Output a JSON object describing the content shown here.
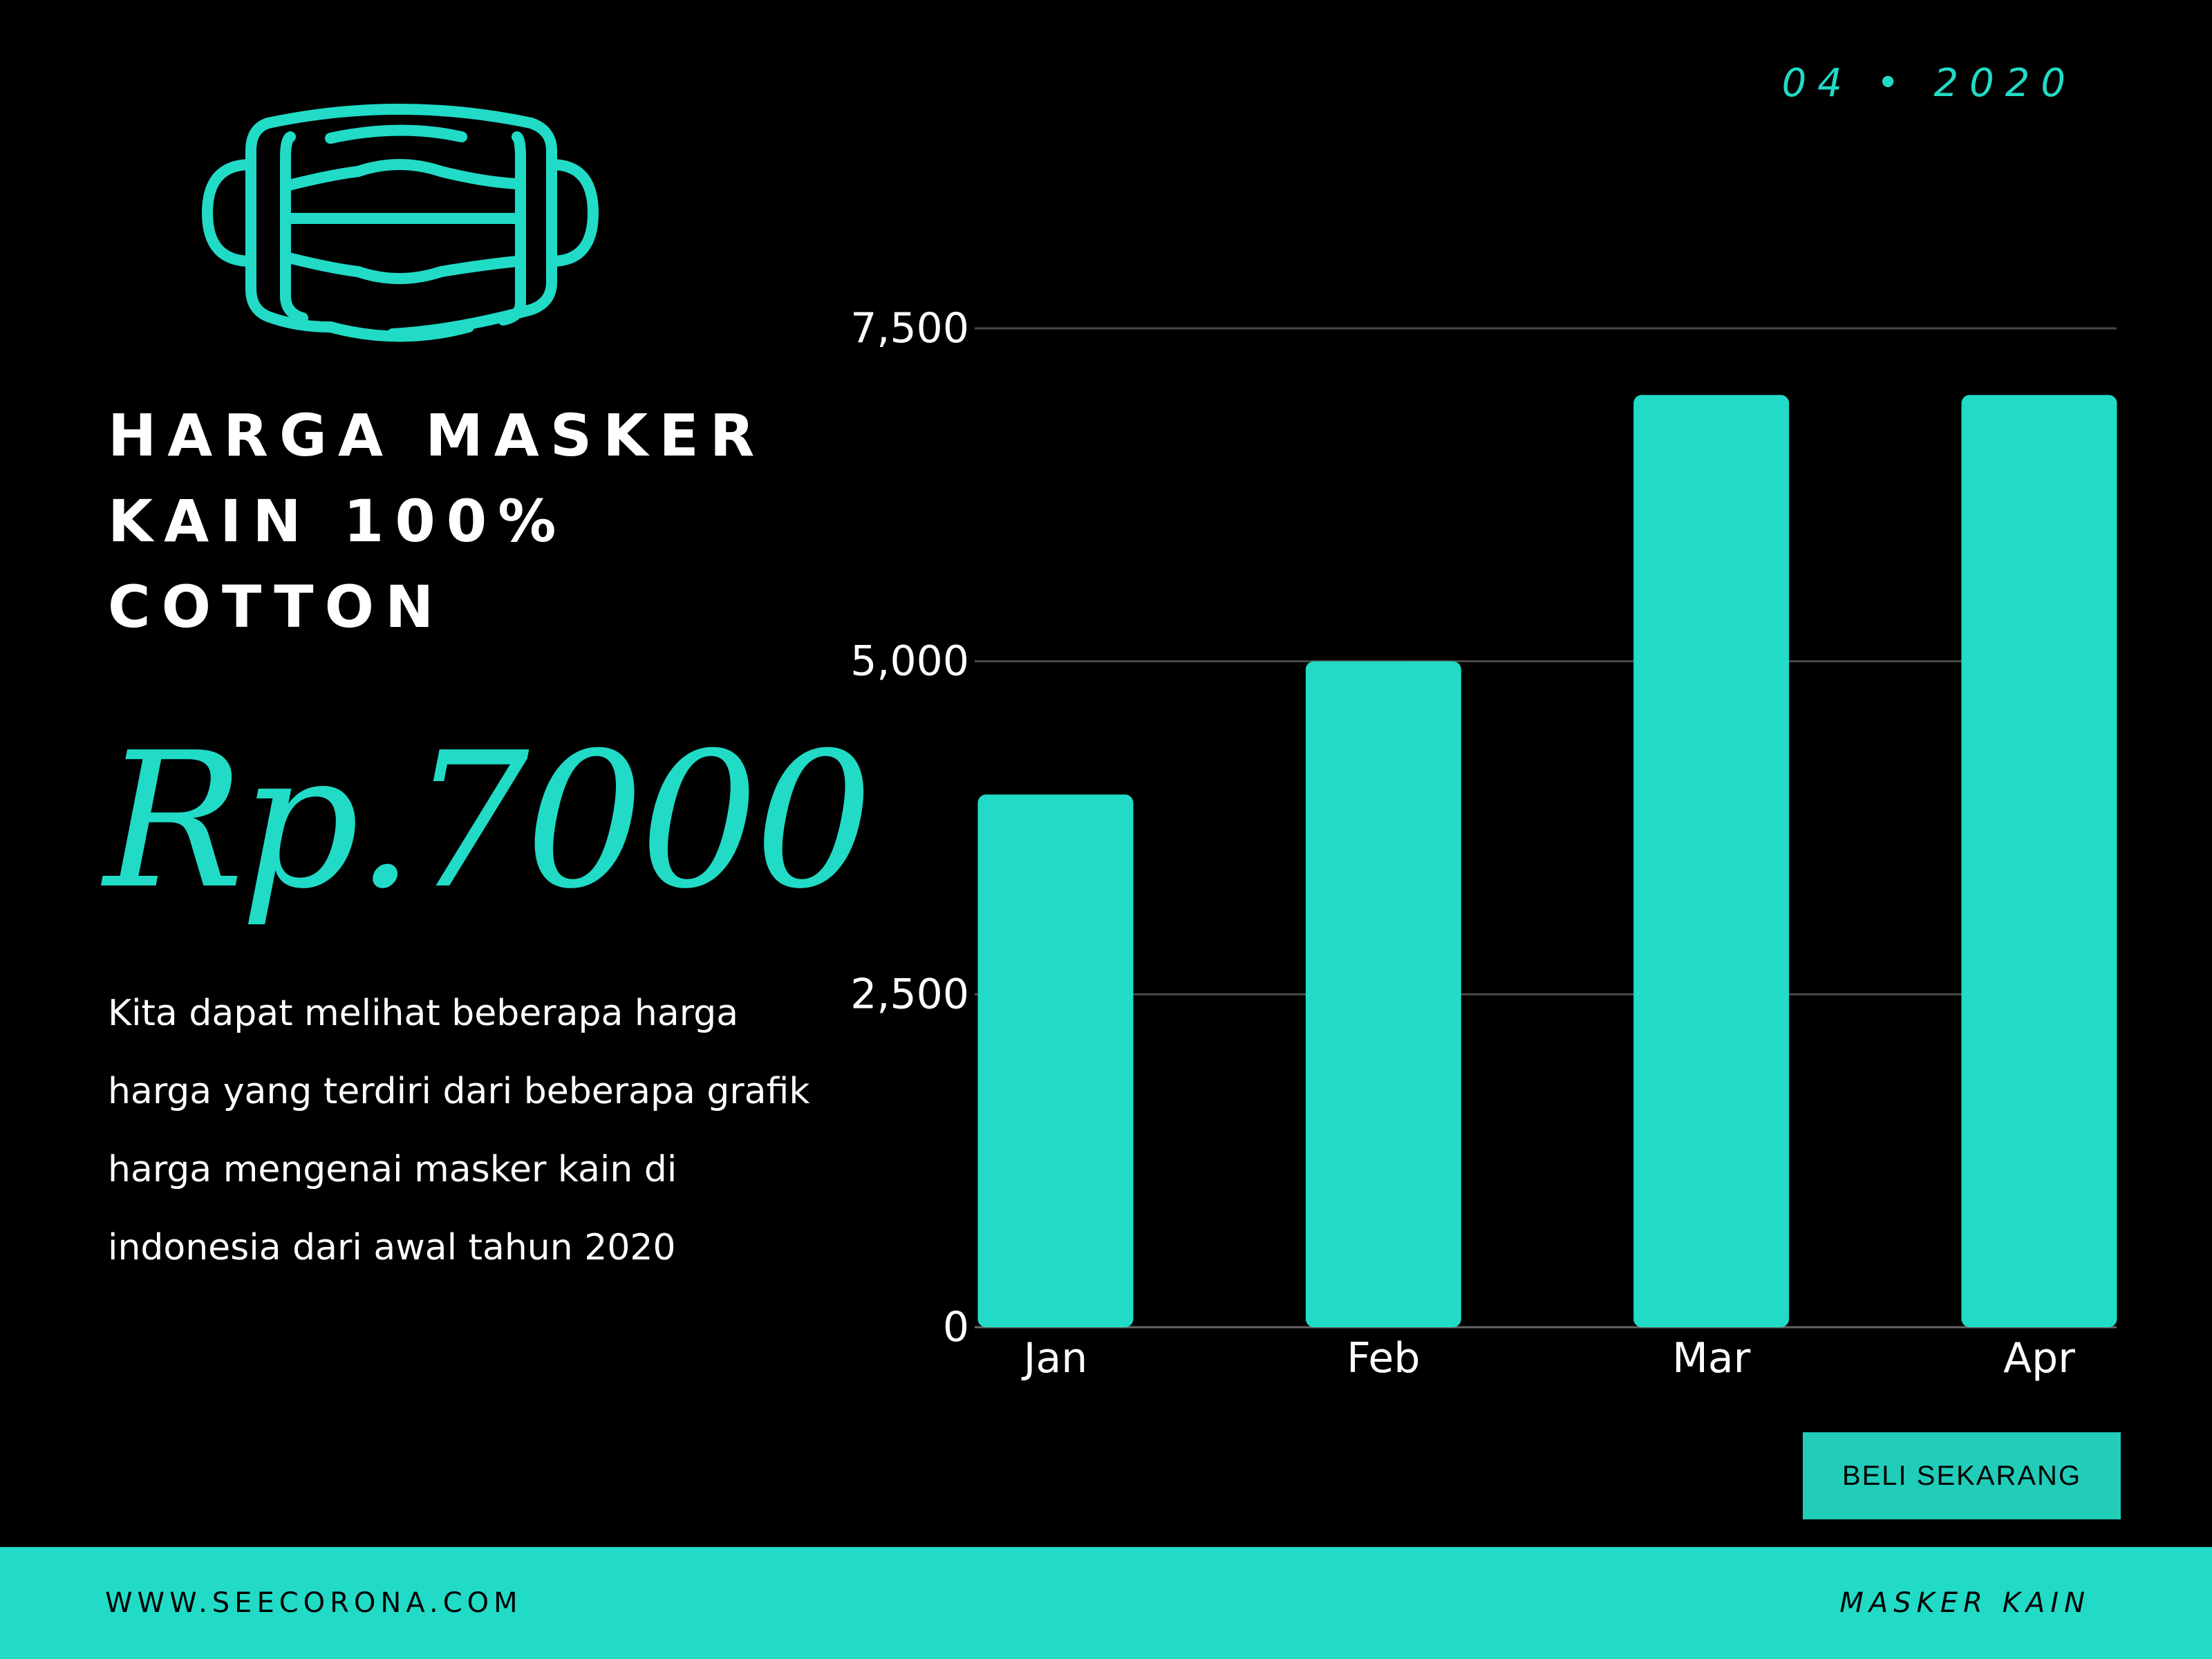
{
  "date_label": "04 • 2020",
  "headline": [
    "HARGA MASKER",
    "KAIN 100%",
    "COTTON"
  ],
  "price": "Rp.7000",
  "description": [
    "Kita dapat melihat beberapa  harga",
    "harga yang terdiri dari beberapa grafik",
    "harga mengenai masker kain di",
    "indonesia dari awal tahun 2020"
  ],
  "cta_button": "BELI SEKARANG",
  "footer": {
    "url": "WWW.SEECORONA.COM",
    "brand": "MASKER KAIN"
  },
  "colors": {
    "accent": "#21DBC7",
    "background": "#000000",
    "text": "#FFFFFF"
  },
  "icon": "face-mask-icon",
  "chart_data": {
    "type": "bar",
    "categories": [
      "Jan",
      "Feb",
      "Mar",
      "Apr"
    ],
    "values": [
      4000,
      5000,
      7000,
      7000
    ],
    "ylim": [
      0,
      7500
    ],
    "yticks": [
      0,
      2500,
      5000,
      7500
    ],
    "ytick_labels": [
      "0",
      "2,500",
      "5,000",
      "7,500"
    ],
    "grid": true,
    "xlabel": "",
    "ylabel": "",
    "title": "",
    "bar_color": "#21DBC7"
  }
}
